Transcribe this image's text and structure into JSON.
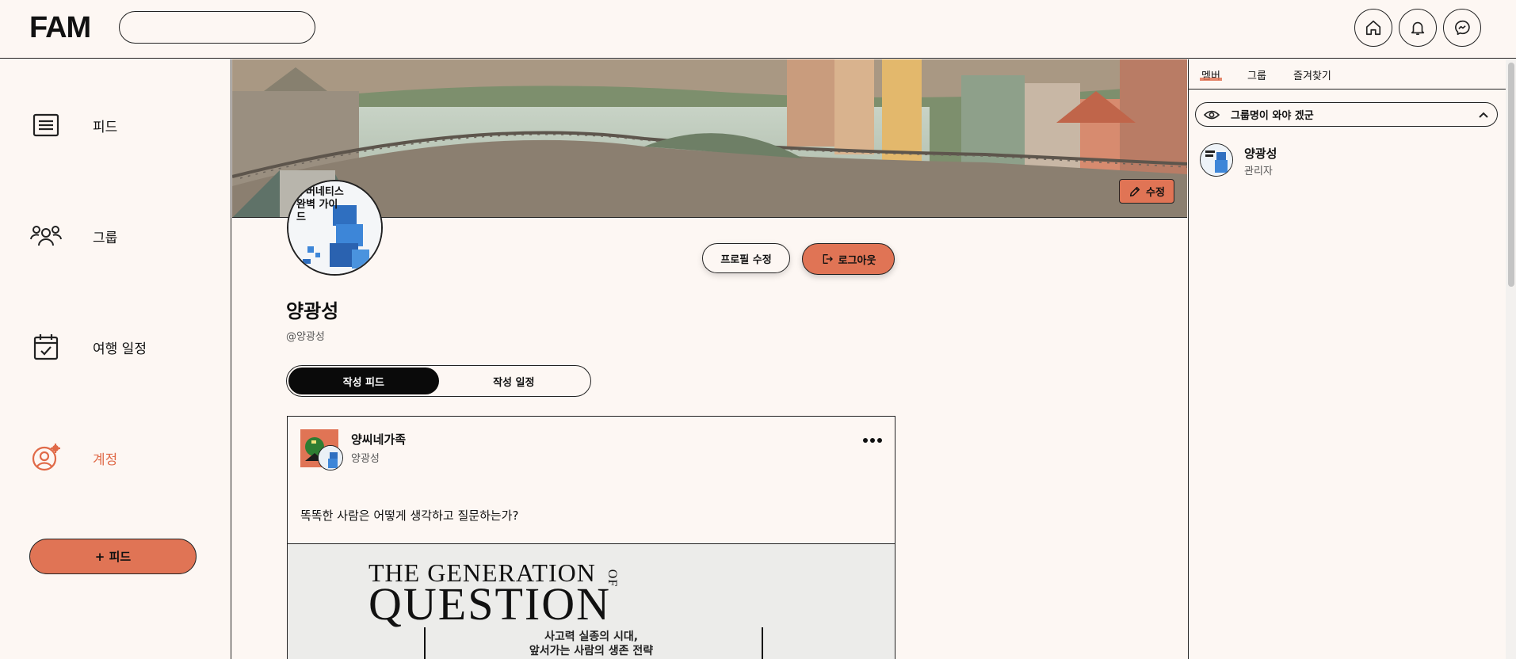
{
  "app": {
    "logo": "FAM"
  },
  "header": {
    "search_placeholder": "",
    "icons": [
      "home-icon",
      "bell-icon",
      "messenger-icon"
    ]
  },
  "sidebar": {
    "items": [
      {
        "label": "피드",
        "icon": "feed-icon"
      },
      {
        "label": "그룹",
        "icon": "group-icon"
      },
      {
        "label": "여행 일정",
        "icon": "calendar-icon"
      },
      {
        "label": "계정",
        "icon": "account-icon",
        "active": true
      }
    ],
    "add_feed_label": "+ 피드"
  },
  "profile": {
    "cover_edit_label": "수정",
    "avatar_text": "쿠버네티스 완벽 가이드",
    "edit_profile_label": "프로필 수정",
    "logout_label": "로그아웃",
    "name": "양광성",
    "handle": "@양광성",
    "tabs": [
      {
        "label": "작성 피드",
        "active": true
      },
      {
        "label": "작성 일정",
        "active": false
      }
    ]
  },
  "post": {
    "group_name": "양씨네가족",
    "author": "양광성",
    "text": "똑똑한 사람은 어떻게 생각하고 질문하는가?",
    "image": {
      "line1": "THE GENERATION",
      "line1_suffix": "OF",
      "line2": "QUESTION",
      "sub1": "사고력 실종의 시대,",
      "sub2": "앞서가는 사람의 생존 전략"
    }
  },
  "right_panel": {
    "tabs": [
      {
        "label": "멤버",
        "active": true
      },
      {
        "label": "그룹",
        "active": false
      },
      {
        "label": "즐겨찾기",
        "active": false
      }
    ],
    "group_select": "그룹명이 와야 겠군",
    "members": [
      {
        "name": "양광성",
        "role": "관리자"
      }
    ]
  },
  "colors": {
    "accent": "#e07455",
    "background": "#fdf7f3",
    "border": "#222222"
  }
}
